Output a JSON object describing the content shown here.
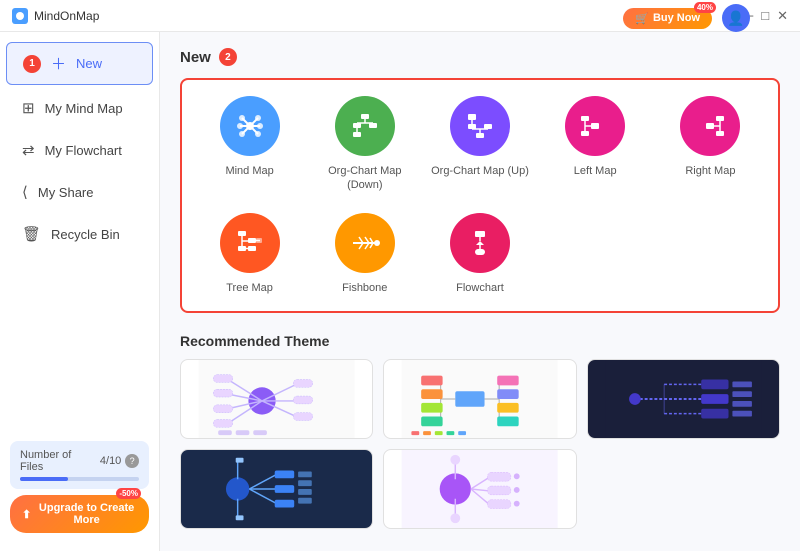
{
  "titlebar": {
    "app_name": "MindOnMap",
    "controls": [
      "hamburger",
      "minimize",
      "maximize",
      "close"
    ],
    "buy_now_label": "Buy Now",
    "buy_now_badge": "40%"
  },
  "sidebar": {
    "items": [
      {
        "id": "new",
        "label": "New",
        "icon": "plus",
        "active": true
      },
      {
        "id": "my-mind-map",
        "label": "My Mind Map",
        "icon": "mind-map"
      },
      {
        "id": "my-flowchart",
        "label": "My Flowchart",
        "icon": "flowchart"
      },
      {
        "id": "my-share",
        "label": "My Share",
        "icon": "share"
      },
      {
        "id": "recycle-bin",
        "label": "Recycle Bin",
        "icon": "trash"
      }
    ],
    "badge_1": "1",
    "files_label": "Number of Files",
    "files_count": "4/10",
    "upgrade_label": "Upgrade to Create More",
    "upgrade_badge": "-50%"
  },
  "new_section": {
    "title": "New",
    "badge": "2",
    "maps": [
      {
        "id": "mind-map",
        "label": "Mind Map",
        "color": "#4a9eff",
        "icon": "mind"
      },
      {
        "id": "org-chart-down",
        "label": "Org-Chart Map (Down)",
        "color": "#4caf50",
        "icon": "org-down"
      },
      {
        "id": "org-chart-up",
        "label": "Org-Chart Map (Up)",
        "color": "#7c4dff",
        "icon": "org-up"
      },
      {
        "id": "left-map",
        "label": "Left Map",
        "color": "#e91e8c",
        "icon": "left"
      },
      {
        "id": "right-map",
        "label": "Right Map",
        "color": "#e91e8c",
        "icon": "right"
      },
      {
        "id": "tree-map",
        "label": "Tree Map",
        "color": "#ff5722",
        "icon": "tree"
      },
      {
        "id": "fishbone",
        "label": "Fishbone",
        "color": "#ff9800",
        "icon": "fishbone"
      },
      {
        "id": "flowchart",
        "label": "Flowchart",
        "color": "#e91e63",
        "icon": "flowchart"
      }
    ]
  },
  "recommended": {
    "title": "Recommended Theme",
    "themes": [
      {
        "id": "theme-1",
        "bg": "#ffffff",
        "style": "light-purple"
      },
      {
        "id": "theme-2",
        "bg": "#ffffff",
        "style": "light-colorful"
      },
      {
        "id": "theme-3",
        "bg": "#1a1f3a",
        "style": "dark-blue"
      },
      {
        "id": "theme-4",
        "bg": "#1a2a4a",
        "style": "dark-navy"
      },
      {
        "id": "theme-5",
        "bg": "#ffffff",
        "style": "light-pastel"
      }
    ]
  },
  "colors": {
    "accent": "#4a6cf7",
    "danger": "#f44336",
    "orange": "#ff7043",
    "sidebar_active_bg": "#eef2ff",
    "sidebar_active_border": "#6c8ef5"
  }
}
